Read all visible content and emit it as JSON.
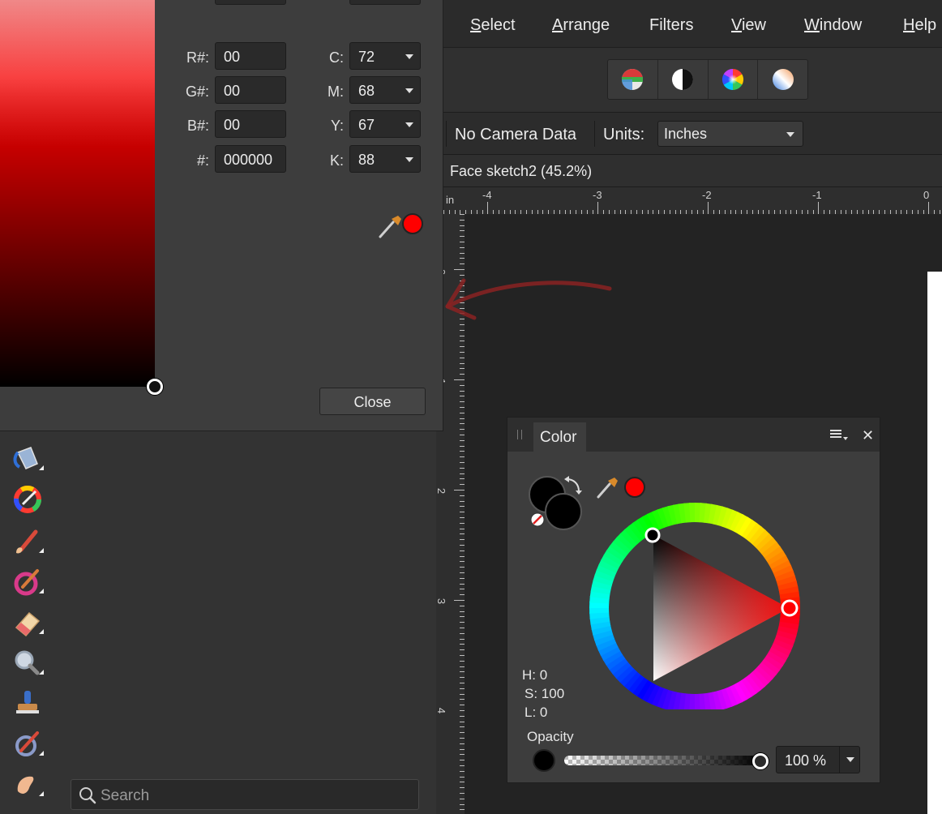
{
  "menubar": {
    "items": [
      {
        "label": "Select",
        "underline": "S",
        "rest": "elect"
      },
      {
        "label": "Arrange",
        "underline": "A",
        "rest": "rrange"
      },
      {
        "label": "Filters",
        "underline": "",
        "rest": "Filters"
      },
      {
        "label": "View",
        "underline": "V",
        "rest": "iew"
      },
      {
        "label": "Window",
        "underline": "W",
        "rest": "indow"
      },
      {
        "label": "Help",
        "underline": "H",
        "rest": "elp"
      }
    ]
  },
  "toolbar": {
    "personas": [
      "develop-persona-icon",
      "tone-mapping-persona-icon",
      "color-wheel-persona-icon",
      "gradient-sphere-persona-icon"
    ]
  },
  "context_bar": {
    "camera_data": "No Camera Data",
    "units_label": "Units:",
    "units_value": "Inches"
  },
  "document": {
    "title": "Face sketch2 (45.2%)"
  },
  "rulers": {
    "unit": "in",
    "horizontal_labels": [
      "-4",
      "-3",
      "-2",
      "-1",
      "0"
    ],
    "vertical_labels": [
      "0",
      "1",
      "2",
      "3",
      "4"
    ]
  },
  "color_dialog": {
    "fields": {
      "r_label": "R#:",
      "r_value": "00",
      "g_label": "G#:",
      "g_value": "00",
      "b_label": "B#:",
      "b_value": "00",
      "hex_label": "#:",
      "hex_value": "000000",
      "c_label": "C:",
      "c_value": "72",
      "m_label": "M:",
      "m_value": "68",
      "y_label": "Y:",
      "y_value": "67",
      "k_label": "K:",
      "k_value": "88"
    },
    "picker_color": "#ff0000",
    "close_label": "Close"
  },
  "tools": {
    "items": [
      "fill-bucket-icon",
      "color-picker-tool-icon",
      "paint-brush-icon",
      "color-replace-brush-icon",
      "eraser-icon",
      "zoom-magnifier-icon",
      "clone-stamp-icon",
      "healing-brush-icon",
      "smudge-icon"
    ]
  },
  "search": {
    "placeholder": "Search"
  },
  "color_panel": {
    "tab_label": "Color",
    "primary_color": "#000000",
    "secondary_color": "#000000",
    "picker_color": "#ff0000",
    "hue": 0,
    "h_text": "H: 0",
    "s_text": "S: 100",
    "l_text": "L: 0",
    "opacity_label": "Opacity",
    "opacity_value": "100 %",
    "opacity_fraction": 1.0
  }
}
